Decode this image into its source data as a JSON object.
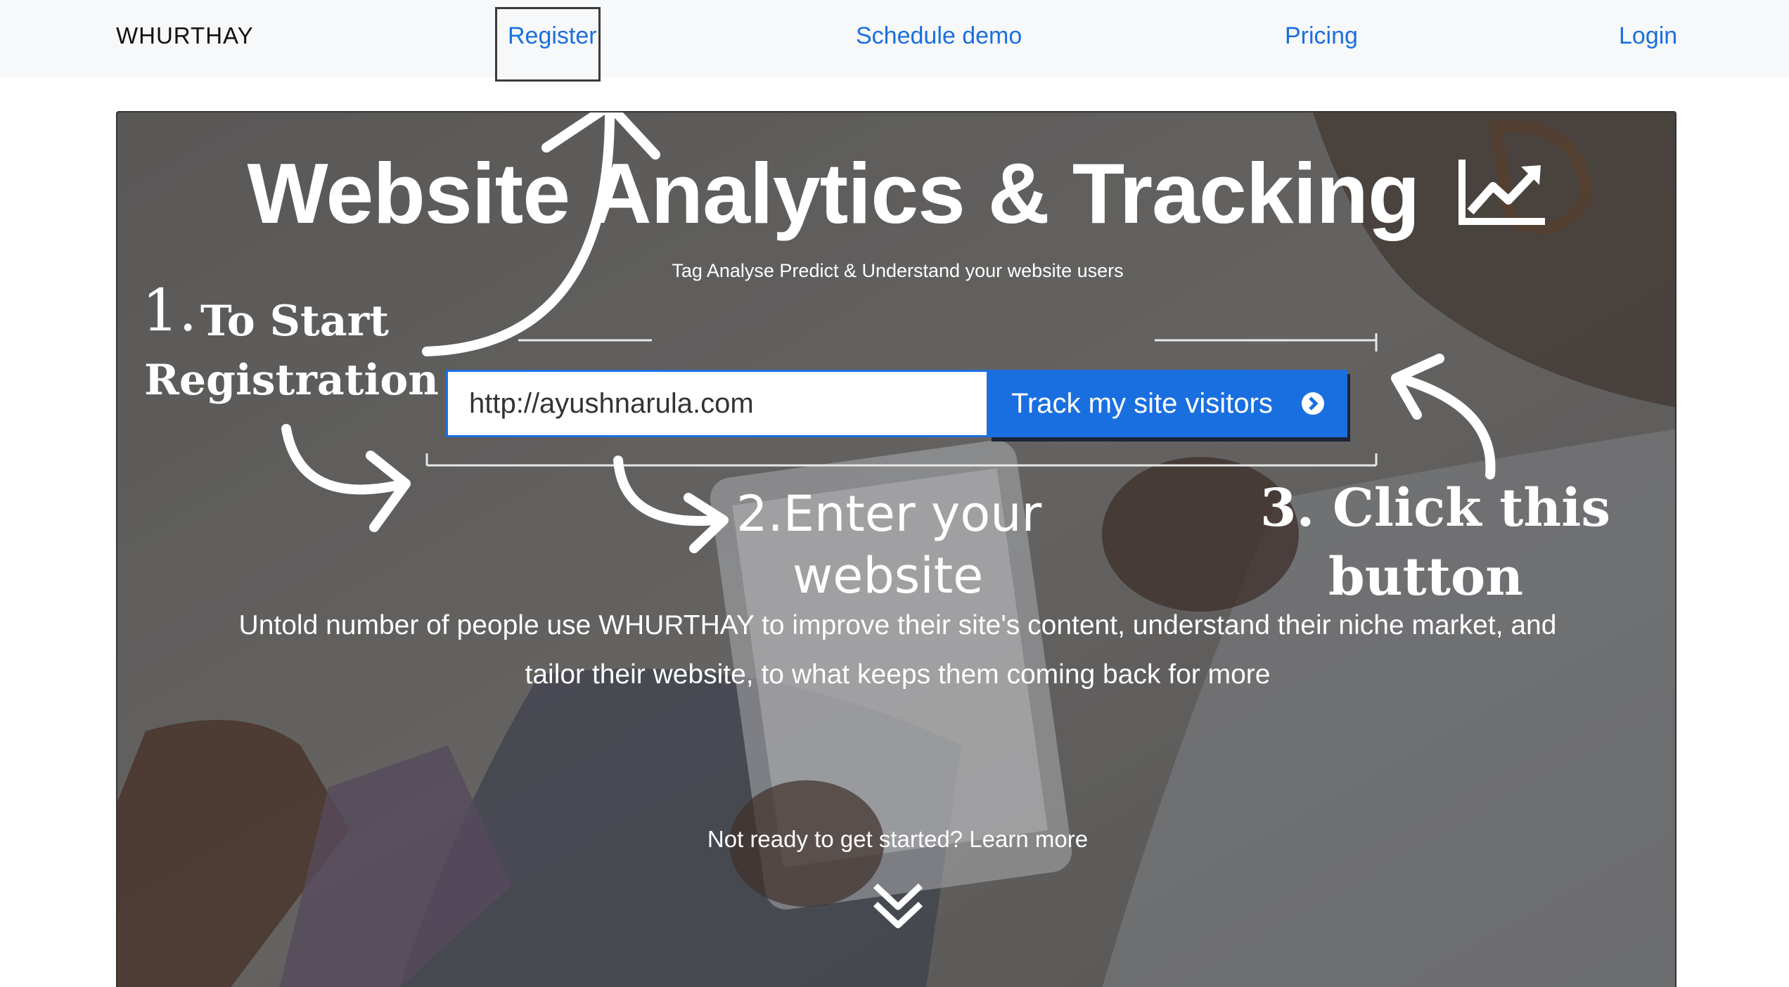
{
  "nav": {
    "brand": "WHURTHAY",
    "links": [
      "Register",
      "Schedule demo",
      "Pricing",
      "Login"
    ]
  },
  "hero": {
    "title": "Website Analytics & Tracking",
    "title_icon": "line-chart-icon",
    "subtitle": "Tag Analyse Predict & Understand your website users",
    "url_input_value": "http://ayushnarula.com",
    "track_button_label": "Track my site visitors",
    "track_button_icon": "arrow-circle-right-icon",
    "description_line1": "Untold number of people use WHURTHAY to improve their site's content, understand their niche market, and",
    "description_line2": "tailor their website, to what keeps them coming back for more",
    "learn_more": "Not ready to get started? Learn more",
    "scroll_icon": "double-chevron-down-icon"
  },
  "annotations": {
    "step1_number": "1.",
    "step1_line1": "To Start",
    "step1_line2": "Registration",
    "step2_line1": "2.Enter your",
    "step2_line2": "website",
    "step3_line1": "3. Click this",
    "step3_line2": "button"
  },
  "colors": {
    "accent": "#1a6fe0",
    "navbar_bg": "#f7f8fa",
    "hero_overlay": "#6b6a69"
  }
}
